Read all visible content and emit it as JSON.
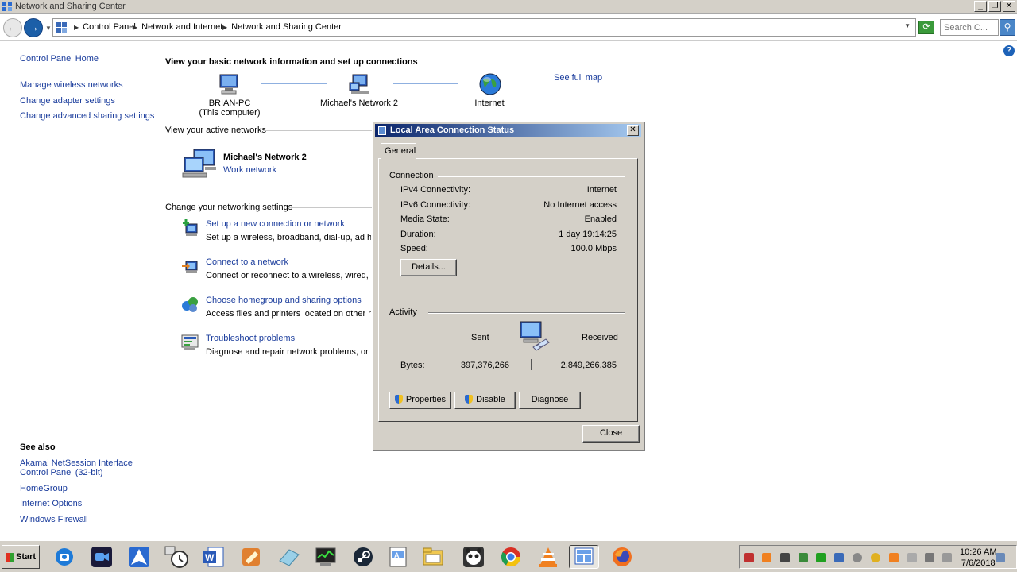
{
  "window": {
    "title": "Network and Sharing Center",
    "buttons": [
      "_",
      "❐",
      "✕"
    ]
  },
  "address": {
    "crumbs": [
      "Control Panel",
      "Network and Internet",
      "Network and Sharing Center"
    ],
    "search_placeholder": "Search C..."
  },
  "left_pane": {
    "home": "Control Panel Home",
    "links": [
      "Manage wireless networks",
      "Change adapter settings",
      "Change advanced sharing settings"
    ],
    "see_also_title": "See also",
    "see_also": [
      "Akamai NetSession Interface Control Panel (32-bit)",
      "HomeGroup",
      "Internet Options",
      "Windows Firewall"
    ]
  },
  "main": {
    "heading": "View your basic network information and set up connections",
    "see_full_map": "See full map",
    "map": [
      {
        "name": "BRIAN-PC",
        "sub": "(This computer)",
        "icon": "computer-icon"
      },
      {
        "name": "Michael's Network  2",
        "sub": "",
        "icon": "network-icon"
      },
      {
        "name": "Internet",
        "sub": "",
        "icon": "globe-icon"
      }
    ],
    "active_networks_label": "View your active networks",
    "active_network": {
      "name": "Michael's Network  2",
      "type": "Work network"
    },
    "settings_label": "Change your networking settings",
    "settings": [
      {
        "title": "Set up a new connection or network",
        "desc": "Set up a wireless, broadband, dial-up, ad hoc, or VPN connection; or set up a router or access point.",
        "icon": "new-connection-icon"
      },
      {
        "title": "Connect to a network",
        "desc": "Connect or reconnect to a wireless, wired, dial-up, or VPN network connection.",
        "icon": "connect-icon"
      },
      {
        "title": "Choose homegroup and sharing options",
        "desc": "Access files and printers located on other network computers, or change sharing settings.",
        "icon": "homegroup-icon"
      },
      {
        "title": "Troubleshoot problems",
        "desc": "Diagnose and repair network problems, or get troubleshooting information.",
        "icon": "troubleshoot-icon"
      }
    ]
  },
  "dialog": {
    "title": "Local Area Connection Status",
    "tab": "General",
    "connection_label": "Connection",
    "rows": [
      {
        "label": "IPv4 Connectivity:",
        "value": "Internet"
      },
      {
        "label": "IPv6 Connectivity:",
        "value": "No Internet access"
      },
      {
        "label": "Media State:",
        "value": "Enabled"
      },
      {
        "label": "Duration:",
        "value": "1 day 19:14:25"
      },
      {
        "label": "Speed:",
        "value": "100.0 Mbps"
      }
    ],
    "details_button": "Details...",
    "activity_label": "Activity",
    "sent_label": "Sent",
    "received_label": "Received",
    "bytes_label": "Bytes:",
    "bytes_sent": "397,376,266",
    "bytes_received": "2,849,266,385",
    "properties_button": "Properties",
    "disable_button": "Disable",
    "diagnose_button": "Diagnose",
    "close_button": "Close"
  },
  "taskbar": {
    "start": "Start",
    "time": "10:26 AM",
    "date": "7/6/2018"
  }
}
